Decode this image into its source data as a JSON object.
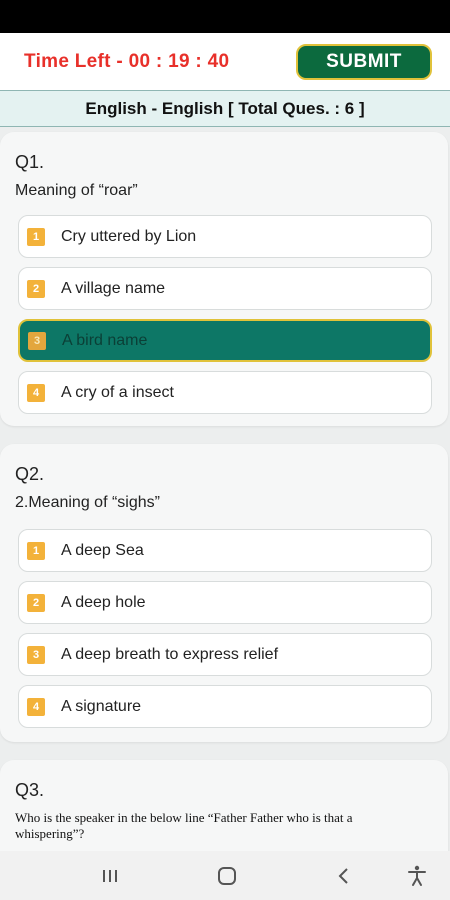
{
  "header": {
    "timer": "Time Left - 00 : 19 : 40",
    "submit_label": "SUBMIT"
  },
  "subject": {
    "title": "English - English [ Total Ques. : 6 ]"
  },
  "questions": [
    {
      "number": "Q1.",
      "text": "Meaning of  “roar”",
      "options": [
        {
          "num": "1",
          "label": "Cry uttered by Lion"
        },
        {
          "num": "2",
          "label": "A village name"
        },
        {
          "num": "3",
          "label": "A bird name",
          "selected": true
        },
        {
          "num": "4",
          "label": "A cry of a insect"
        }
      ]
    },
    {
      "number": "Q2.",
      "text": "2.Meaning of “sighs”",
      "options": [
        {
          "num": "1",
          "label": "A deep Sea"
        },
        {
          "num": "2",
          "label": "A deep hole"
        },
        {
          "num": "3",
          "label": "A deep breath to express relief"
        },
        {
          "num": "4",
          "label": "A signature"
        }
      ]
    },
    {
      "number": "Q3.",
      "text": "Who is the speaker in the below line “Father Father who is that a whispering”?"
    }
  ],
  "colors": {
    "timer": "#e8302a",
    "submit_bg": "#0c6a3e",
    "selected_option_bg": "#0d7766",
    "option_number_bg": "#f3b23a"
  },
  "navbar": {
    "icons": [
      "recent-apps-icon",
      "home-icon",
      "back-icon",
      "accessibility-icon"
    ]
  }
}
